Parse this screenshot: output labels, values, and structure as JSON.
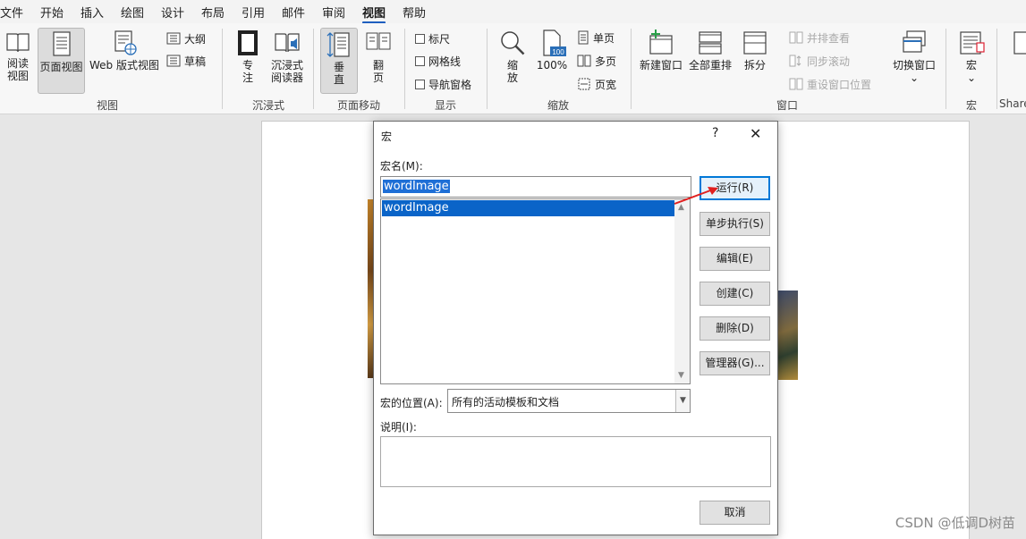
{
  "menubar": {
    "items": [
      "文件",
      "开始",
      "插入",
      "绘图",
      "设计",
      "布局",
      "引用",
      "邮件",
      "审阅",
      "视图",
      "帮助"
    ],
    "active": "视图"
  },
  "ribbon": {
    "groups": {
      "views": "视图",
      "immersive": "沉浸式",
      "page_movement": "页面移动",
      "show": "显示",
      "zoom": "缩放",
      "window": "窗口",
      "macros": "宏"
    },
    "views": {
      "read_mode_1": "阅读",
      "read_mode_2": "视图",
      "print_layout": "页面视图",
      "web_layout": "Web 版式视图",
      "outline": "大纲",
      "draft": "草稿"
    },
    "immersive": {
      "focus_1": "专",
      "focus_2": "注",
      "reader_1": "沉浸式",
      "reader_2": "阅读器"
    },
    "page_movement": {
      "vertical_1": "垂",
      "vertical_2": "直",
      "side_1": "翻",
      "side_2": "页"
    },
    "show": {
      "ruler": "标尺",
      "gridlines": "网格线",
      "nav_pane": "导航窗格"
    },
    "zoom": {
      "zoom_1": "缩",
      "zoom_2": "放",
      "percent": "100%",
      "icon_text": "100",
      "one_page": "单页",
      "multi_page": "多页",
      "page_width": "页宽"
    },
    "window": {
      "new_window": "新建窗口",
      "arrange_all": "全部重排",
      "split": "拆分",
      "side_by_side": "并排查看",
      "sync_scroll": "同步滚动",
      "reset_position": "重设窗口位置",
      "switch_windows": "切换窗口"
    },
    "macros": {
      "macros": "宏",
      "share_partial": "Share"
    }
  },
  "dialog": {
    "title": "宏",
    "help": "?",
    "macro_name_label": "宏名(M):",
    "macro_name_value": "wordImage",
    "macro_list": [
      "wordImage"
    ],
    "buttons": {
      "run": "运行(R)",
      "step_into": "单步执行(S)",
      "edit": "编辑(E)",
      "create": "创建(C)",
      "delete": "删除(D)",
      "organizer": "管理器(G)...",
      "cancel": "取消"
    },
    "location_label": "宏的位置(A):",
    "location_value": "所有的活动模板和文档",
    "description_label": "说明(I):"
  },
  "watermark": "CSDN @低调D树苗"
}
